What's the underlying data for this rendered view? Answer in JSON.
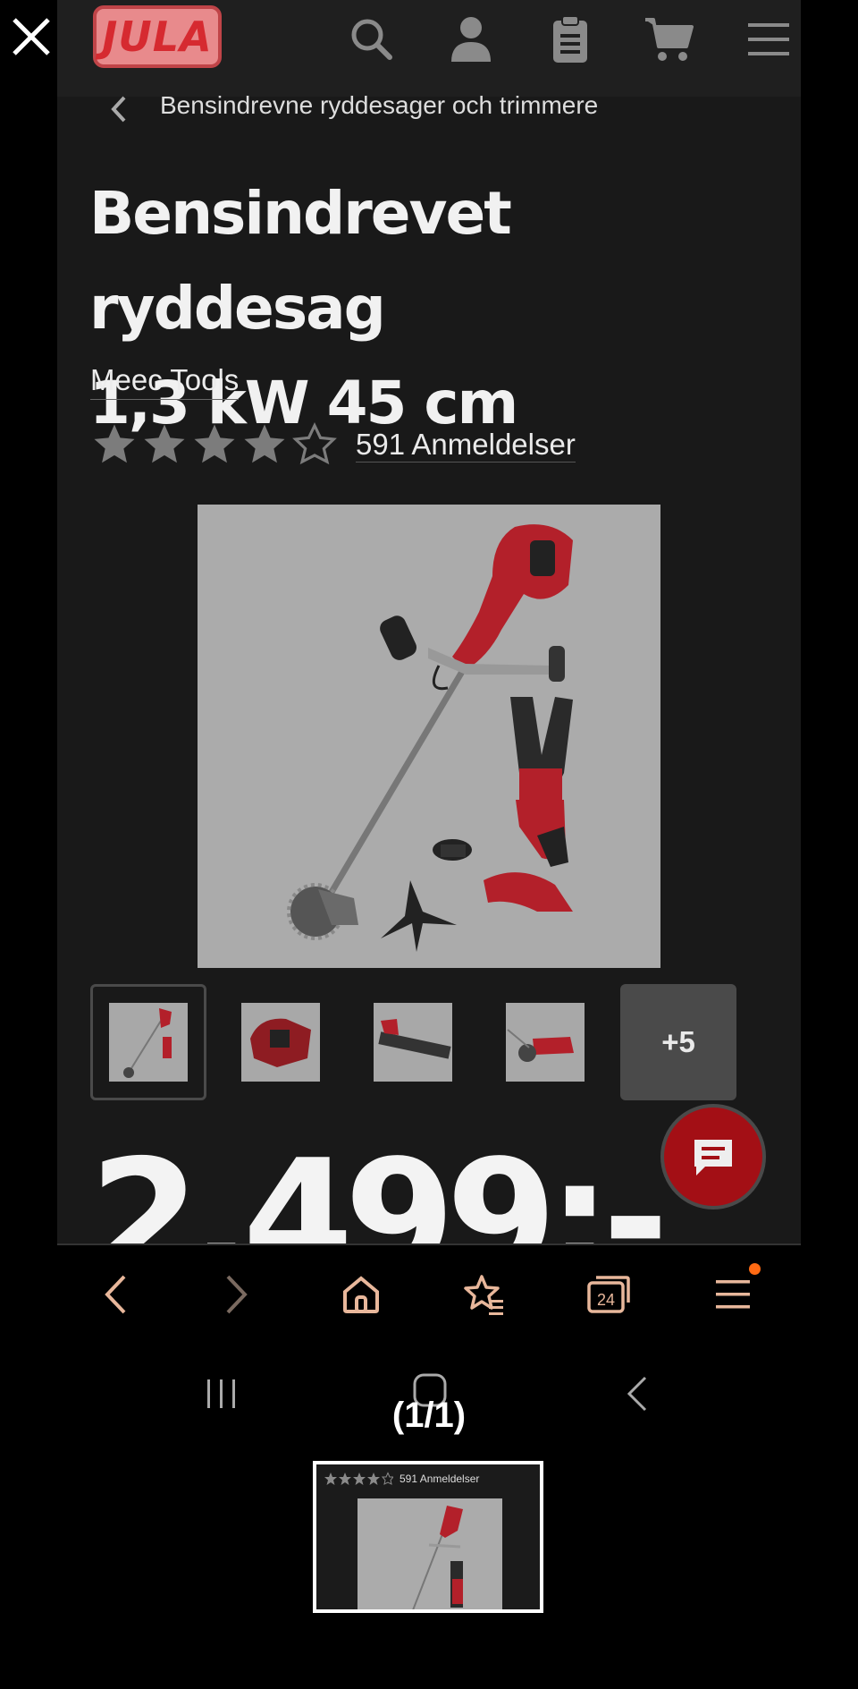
{
  "overlay": {
    "close_icon": "close-icon"
  },
  "header": {
    "logo_text": "JULA",
    "icons": [
      "search-icon",
      "account-icon",
      "clipboard-icon",
      "cart-icon",
      "menu-icon"
    ]
  },
  "breadcrumb": {
    "label": "Bensindrevne ryddesager och trimmere"
  },
  "product": {
    "title_line1": "Bensindrevet ryddesag",
    "title_line2": "1,3 kW 45 cm",
    "brand": "Meec Tools",
    "rating": 4,
    "rating_max": 5,
    "reviews_label": "591 Anmeldelser",
    "thumbnails_more": "+5",
    "price": "2.499:-"
  },
  "browser_toolbar": {
    "icons": [
      "back-icon",
      "forward-icon",
      "home-icon",
      "bookmarks-icon",
      "tabs-icon",
      "menu-icon"
    ],
    "tabs_count": "24"
  },
  "viewer": {
    "counter": "(1/1)",
    "preview_reviews": "591 Anmeldelser"
  },
  "colors": {
    "accent": "#a30f15",
    "brand_red": "#d62a30",
    "badge_orange": "#ff6a13",
    "background": "#191919"
  }
}
